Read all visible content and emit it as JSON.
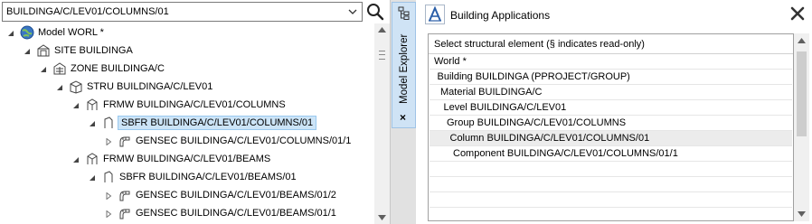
{
  "explorer": {
    "search_value": "BUILDINGA/C/LEV01/COLUMNS/01",
    "tab_label": "Model Explorer",
    "tab_close": "×",
    "tree": [
      {
        "label": "Model WORL *",
        "icon": "globe-icon",
        "expanded": true
      },
      {
        "label": "SITE BUILDINGA",
        "icon": "site-icon",
        "expanded": true
      },
      {
        "label": "ZONE BUILDINGA/C",
        "icon": "zone-icon",
        "expanded": true
      },
      {
        "label": "STRU BUILDINGA/C/LEV01",
        "icon": "structure-icon",
        "expanded": true
      },
      {
        "label": "FRMW BUILDINGA/C/LEV01/COLUMNS",
        "icon": "framework-icon",
        "expanded": true
      },
      {
        "label": "SBFR BUILDINGA/C/LEV01/COLUMNS/01",
        "icon": "subframe-icon",
        "expanded": true,
        "selected": true
      },
      {
        "label": "GENSEC BUILDINGA/C/LEV01/COLUMNS/01/1",
        "icon": "section-icon",
        "expanded": false
      },
      {
        "label": "FRMW BUILDINGA/C/LEV01/BEAMS",
        "icon": "framework-icon",
        "expanded": true
      },
      {
        "label": "SBFR BUILDINGA/C/LEV01/BEAMS/01",
        "icon": "subframe-icon",
        "expanded": true
      },
      {
        "label": "GENSEC BUILDINGA/C/LEV01/BEAMS/01/2",
        "icon": "section-icon",
        "expanded": false
      },
      {
        "label": "GENSEC BUILDINGA/C/LEV01/BEAMS/01/1",
        "icon": "section-icon",
        "expanded": false
      }
    ]
  },
  "app": {
    "title": "Building Applications",
    "close": "✕",
    "panel_header": "Select structural element (§ indicates read-only)",
    "elements": [
      {
        "label": "World *",
        "level": 0
      },
      {
        "label": "Building BUILDINGA (PPROJECT/GROUP)",
        "level": 1
      },
      {
        "label": "Material BUILDINGA/C",
        "level": 2
      },
      {
        "label": "Level BUILDINGA/C/LEV01",
        "level": 3
      },
      {
        "label": "Group BUILDINGA/C/LEV01/COLUMNS",
        "level": 4
      },
      {
        "label": "Column BUILDINGA/C/LEV01/COLUMNS/01",
        "level": 5,
        "highlighted": true
      },
      {
        "label": "Component BUILDINGA/C/LEV01/COLUMNS/01/1",
        "level": 6
      },
      {
        "label": "",
        "level": 0
      },
      {
        "label": "",
        "level": 0
      },
      {
        "label": "",
        "level": 0
      }
    ]
  },
  "colors": {
    "selection_bg": "#cce4f7",
    "selection_border": "#99c9ef",
    "dock_tab_bg": "#cfe3f5",
    "highlight_row": "#ececec"
  }
}
